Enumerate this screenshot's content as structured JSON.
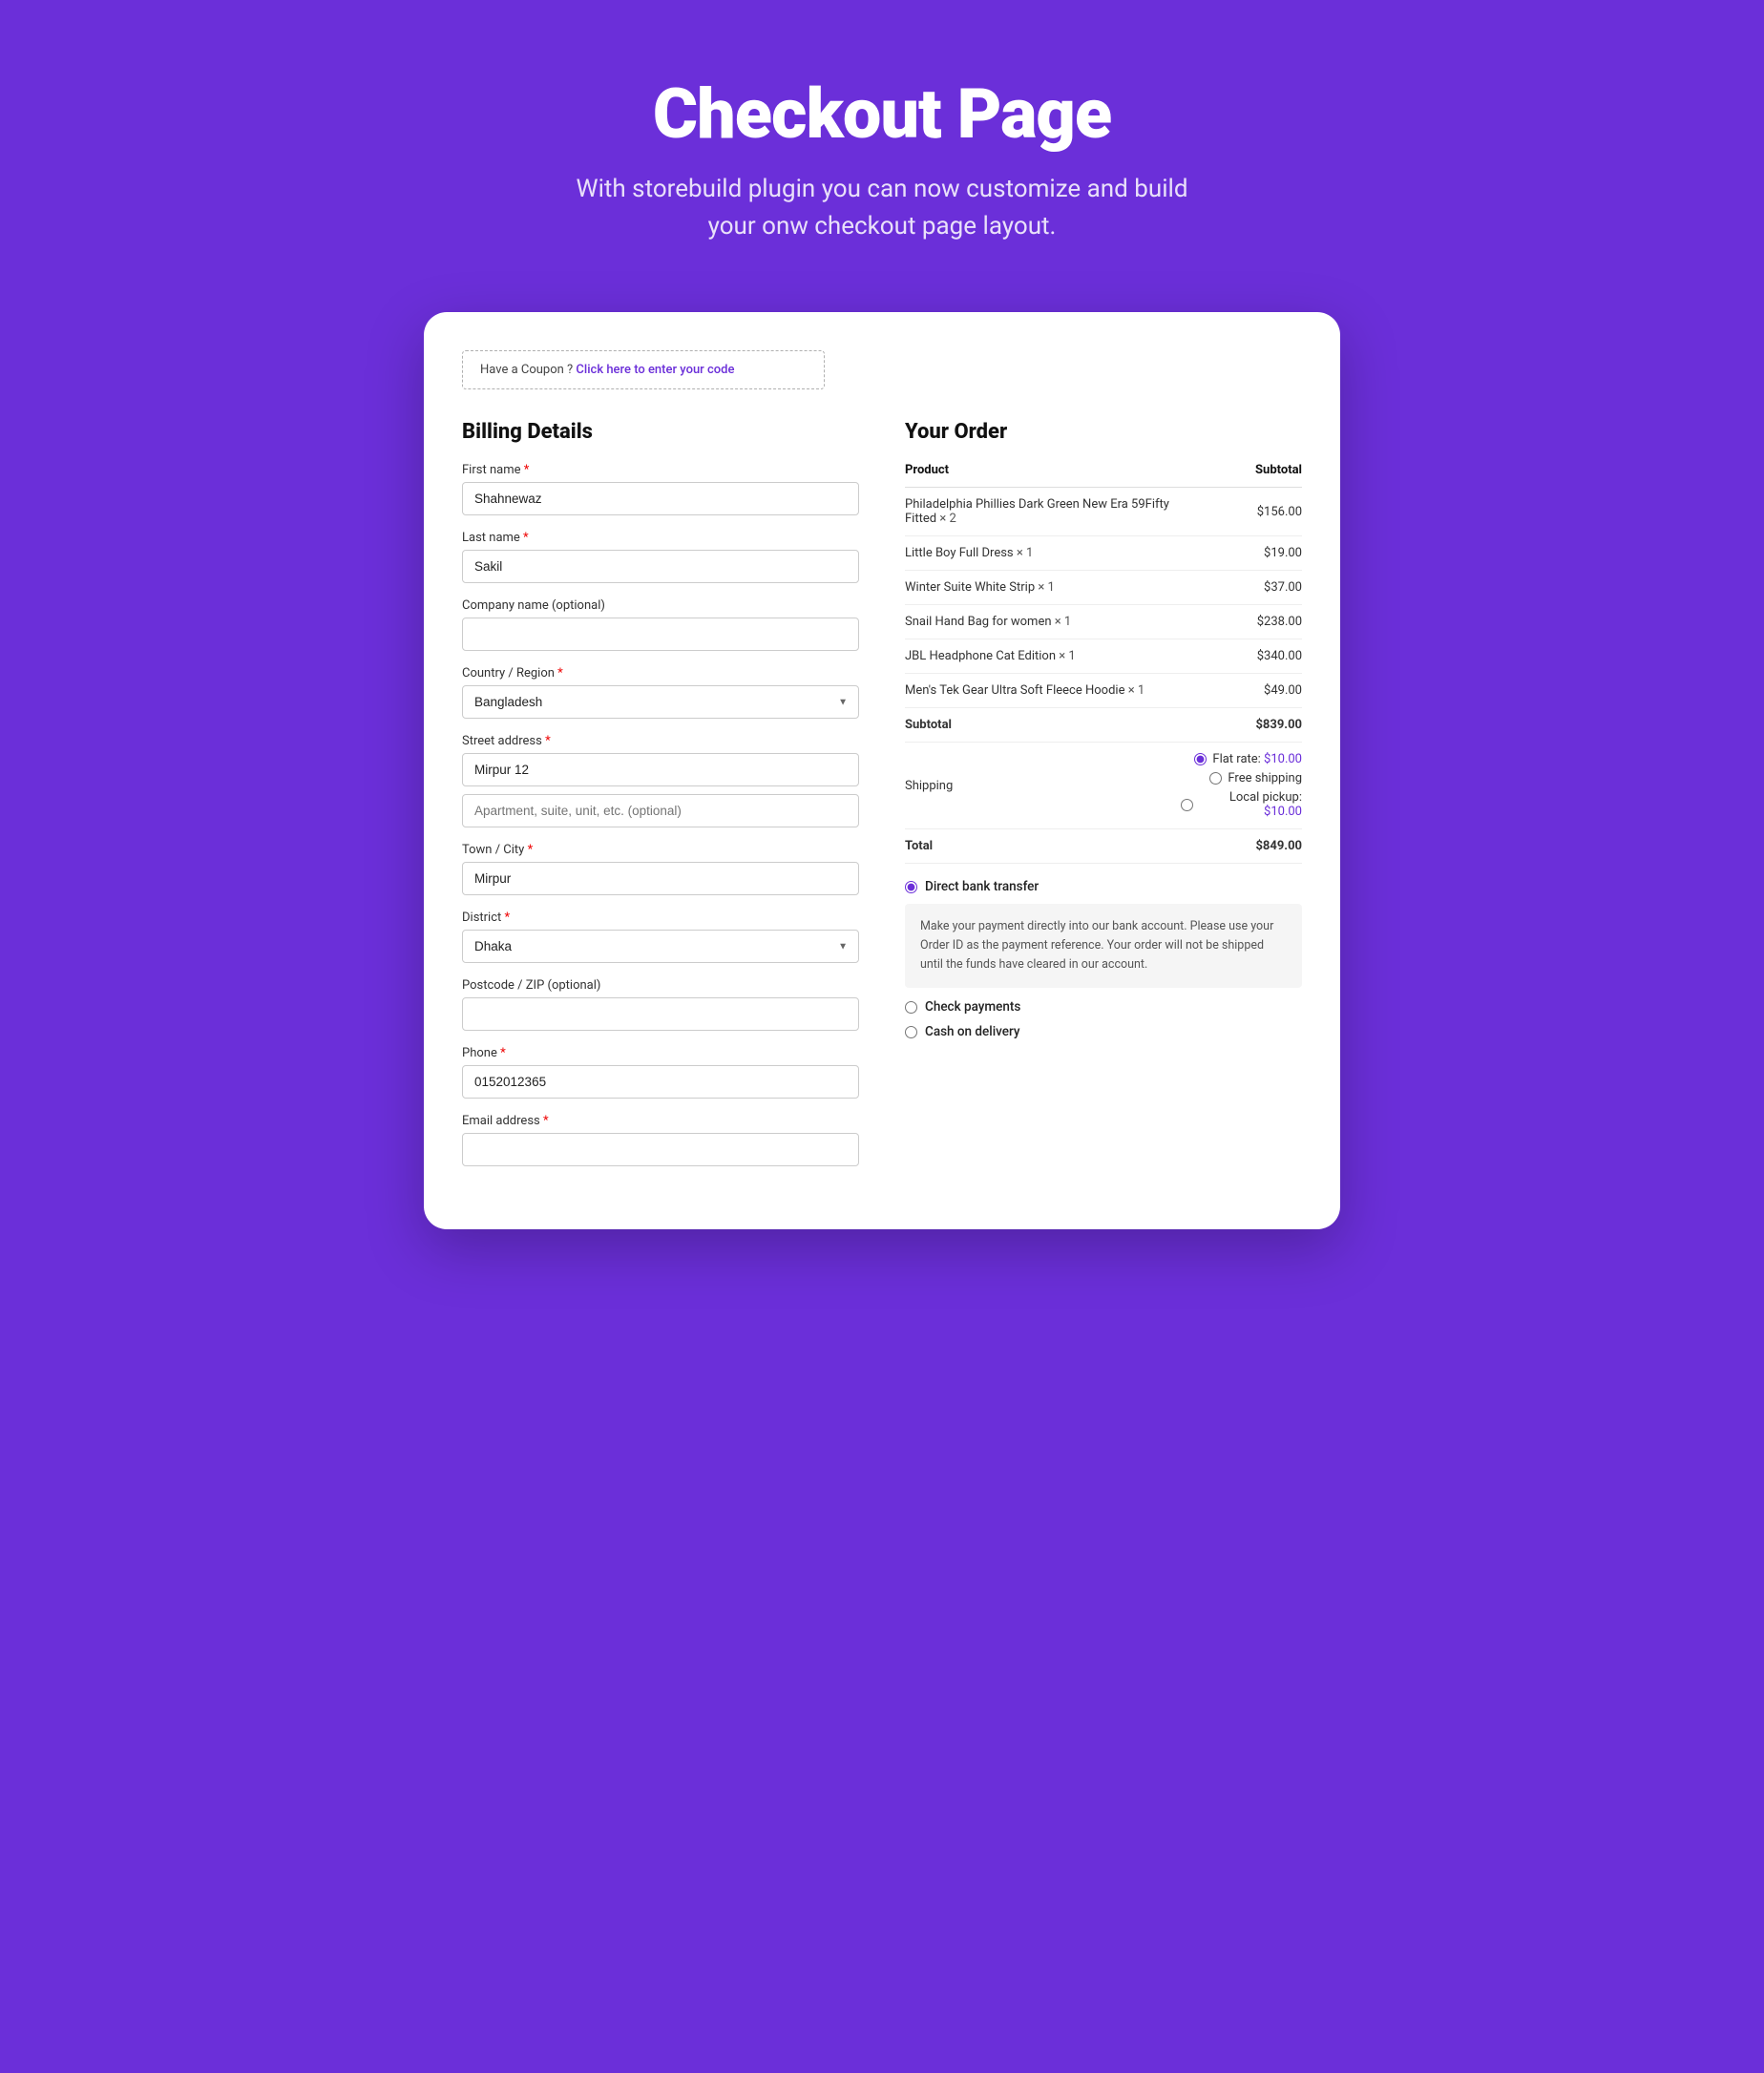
{
  "hero": {
    "title": "Checkout Page",
    "subtitle": "With storebuild plugin you can now customize and build your onw checkout page layout."
  },
  "coupon": {
    "text": "Have a Coupon ?",
    "link_text": "Click here to enter your code"
  },
  "billing": {
    "section_title": "Billing Details",
    "fields": {
      "first_name_label": "First name",
      "first_name_value": "Shahnewaz",
      "last_name_label": "Last name",
      "last_name_value": "Sakil",
      "company_label": "Company name (optional)",
      "company_value": "",
      "country_label": "Country / Region",
      "country_value": "Bangladesh",
      "street_label": "Street address",
      "street_value": "Mirpur 12",
      "street_placeholder2": "Apartment, suite, unit, etc. (optional)",
      "city_label": "Town / City",
      "city_value": "Mirpur",
      "district_label": "District",
      "district_value": "Dhaka",
      "postcode_label": "Postcode / ZIP (optional)",
      "postcode_value": "",
      "phone_label": "Phone",
      "phone_value": "0152012365",
      "email_label": "Email address"
    }
  },
  "order": {
    "section_title": "Your Order",
    "columns": {
      "product": "Product",
      "subtotal": "Subtotal"
    },
    "items": [
      {
        "name": "Philadelphia Phillies Dark Green New Era 59Fifty Fitted",
        "qty": "× 2",
        "price": "$156.00"
      },
      {
        "name": "Little Boy Full Dress",
        "qty": "× 1",
        "price": "$19.00"
      },
      {
        "name": "Winter Suite White Strip",
        "qty": "× 1",
        "price": "$37.00"
      },
      {
        "name": "Snail Hand Bag for women",
        "qty": "× 1",
        "price": "$238.00"
      },
      {
        "name": "JBL Headphone Cat Edition",
        "qty": "× 1",
        "price": "$340.00"
      },
      {
        "name": "Men's Tek Gear Ultra Soft Fleece Hoodie",
        "qty": "× 1",
        "price": "$49.00"
      }
    ],
    "subtotal_label": "Subtotal",
    "subtotal_value": "$839.00",
    "shipping_label": "Shipping",
    "shipping_options": [
      {
        "label": "Flat rate:",
        "value": "$10.00",
        "checked": true
      },
      {
        "label": "Free shipping",
        "value": "",
        "checked": false
      },
      {
        "label": "Local pickup:",
        "value": "$10.00",
        "checked": false
      }
    ],
    "total_label": "Total",
    "total_value": "$849.00",
    "payment_options": [
      {
        "label": "Direct bank transfer",
        "checked": true
      },
      {
        "label": "Check payments",
        "checked": false
      },
      {
        "label": "Cash on delivery",
        "checked": false
      }
    ],
    "bank_info": "Make your payment directly into our bank account. Please use your Order ID as the payment reference. Your order will not be shipped until the funds have cleared in our account."
  }
}
